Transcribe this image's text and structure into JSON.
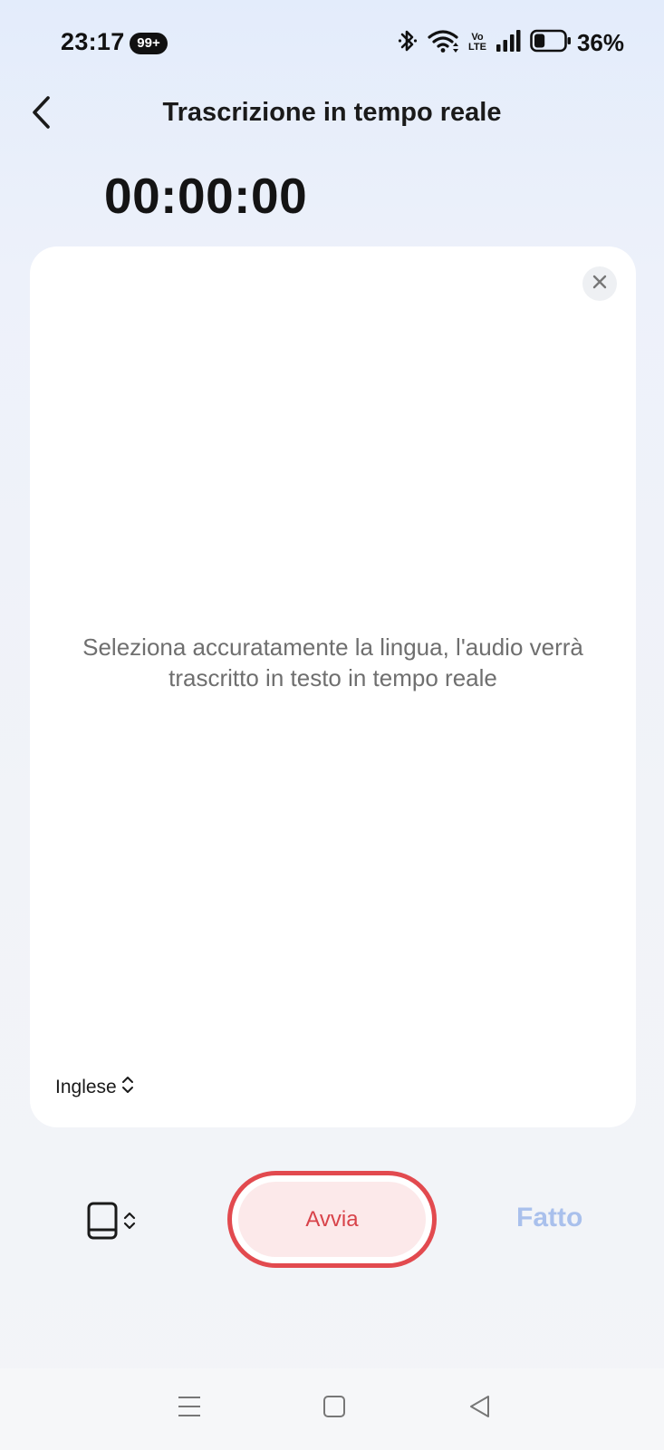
{
  "status_bar": {
    "time": "23:17",
    "notification_badge": "99+",
    "icons": [
      "bluetooth-icon",
      "wifi-icon",
      "volte-icon",
      "signal-icon",
      "battery-icon"
    ],
    "volte_top": "Vo",
    "volte_bottom": "LTE",
    "battery_percent": "36%",
    "battery_level": 0.36
  },
  "header": {
    "title": "Trascrizione in tempo reale",
    "back_icon": "chevron-left-icon"
  },
  "timer": {
    "value": "00:00:00",
    "icon": "audio-wave-icon"
  },
  "card": {
    "hint": "Seleziona accuratamente la lingua, l'audio verrà trascritto in testo in tempo reale",
    "language": "Inglese",
    "close_icon": "close-icon"
  },
  "controls": {
    "source_icon": "tablet-icon",
    "start_label": "Avvia",
    "done_label": "Fatto"
  },
  "colors": {
    "accent_red": "#e24a4f",
    "done_disabled": "#a9c0ec",
    "wave_gradient": [
      "#3cc5d8",
      "#3b7be0",
      "#9a5ce0"
    ]
  }
}
